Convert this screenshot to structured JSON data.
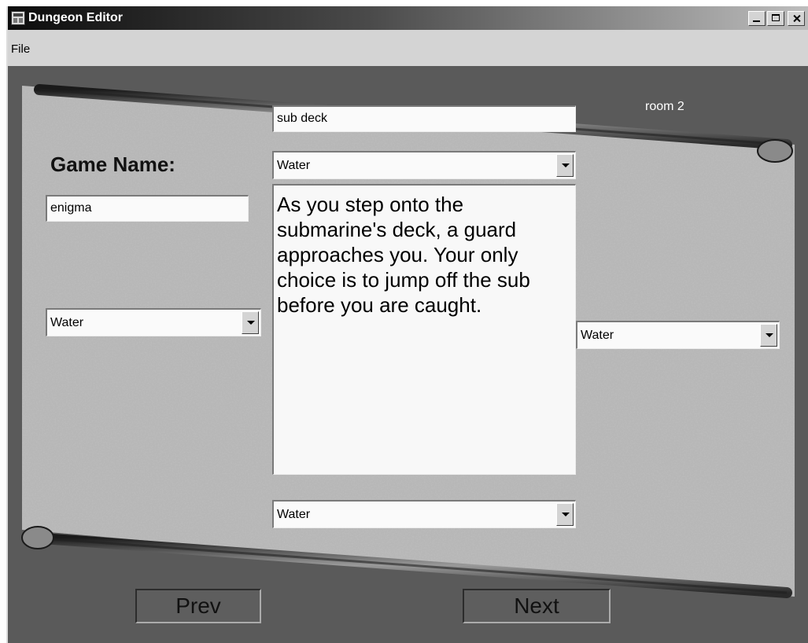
{
  "window": {
    "title": "Dungeon Editor"
  },
  "menu": {
    "file": "File"
  },
  "editor": {
    "room_label": "room 2",
    "room_name": "sub deck",
    "game_name_label": "Game Name:",
    "game_name": "enigma",
    "exit_north": "Water",
    "exit_west": "Water",
    "exit_east": "Water",
    "exit_south": "Water",
    "description": "As you step onto the submarine's deck, a guard approaches you. Your only choice is to jump off the sub before you are caught.",
    "prev_label": "Prev",
    "next_label": "Next"
  }
}
